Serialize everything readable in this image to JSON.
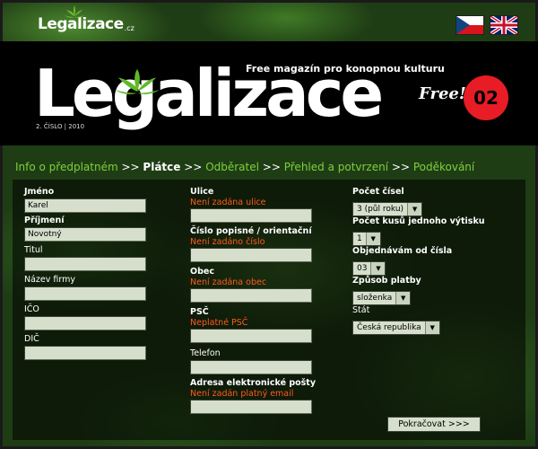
{
  "top_logo": {
    "legal": "Legal",
    "izace": "izace",
    "tld": ".cz"
  },
  "languages": [
    "cs-flag-icon",
    "uk-flag-icon"
  ],
  "header": {
    "tagline": "Free magazín pro konopnou kulturu",
    "title": "Legalizace",
    "issue": "2. ČÍSLO | 2010",
    "free": "Free!",
    "issue_badge": "02"
  },
  "breadcrumb": {
    "step1": "Info o předplatném",
    "step2": "Plátce",
    "step3": "Odběratel",
    "step4": "Přehled a potvrzení",
    "step5": "Poděkování",
    "sep": ">>"
  },
  "form": {
    "col1": {
      "jmeno_label": "Jméno",
      "jmeno_value": "Karel",
      "prijmeni_label": "Příjmení",
      "prijmeni_value": "Novotný",
      "titul_label": "Titul",
      "titul_value": "",
      "firma_label": "Název firmy",
      "firma_value": "",
      "ico_label": "IČO",
      "ico_value": "",
      "dic_label": "DIČ",
      "dic_value": ""
    },
    "col2": {
      "ulice_label": "Ulice",
      "ulice_error": "Není zadána ulice",
      "ulice_value": "",
      "cislo_label": "Číslo popisné / orientační",
      "cislo_error": "Není zadáno číslo",
      "cislo_value": "",
      "obec_label": "Obec",
      "obec_error": "Není zadána obec",
      "obec_value": "",
      "psc_label": "PSČ",
      "psc_error": "Neplatné PSČ",
      "psc_value": "",
      "telefon_label": "Telefon",
      "telefon_value": "",
      "email_label": "Adresa elektronické pošty",
      "email_error": "Není zadán platný email",
      "email_value": ""
    },
    "col3": {
      "pocet_cisel_label": "Počet čísel",
      "pocet_cisel_value": "3 (půl roku)",
      "pocet_kusu_label": "Počet kusů jednoho výtisku",
      "pocet_kusu_value": "1",
      "od_cisla_label": "Objednávám od čísla",
      "od_cisla_value": "03",
      "platba_label": "Způsob platby",
      "platba_value": "složenka",
      "stat_label": "Stát",
      "stat_value": "Česká republika"
    },
    "submit_label": "Pokračovat >>>"
  },
  "colors": {
    "accent_green": "#7dd13a",
    "error": "#ff5a1e",
    "badge": "#e81c24"
  }
}
